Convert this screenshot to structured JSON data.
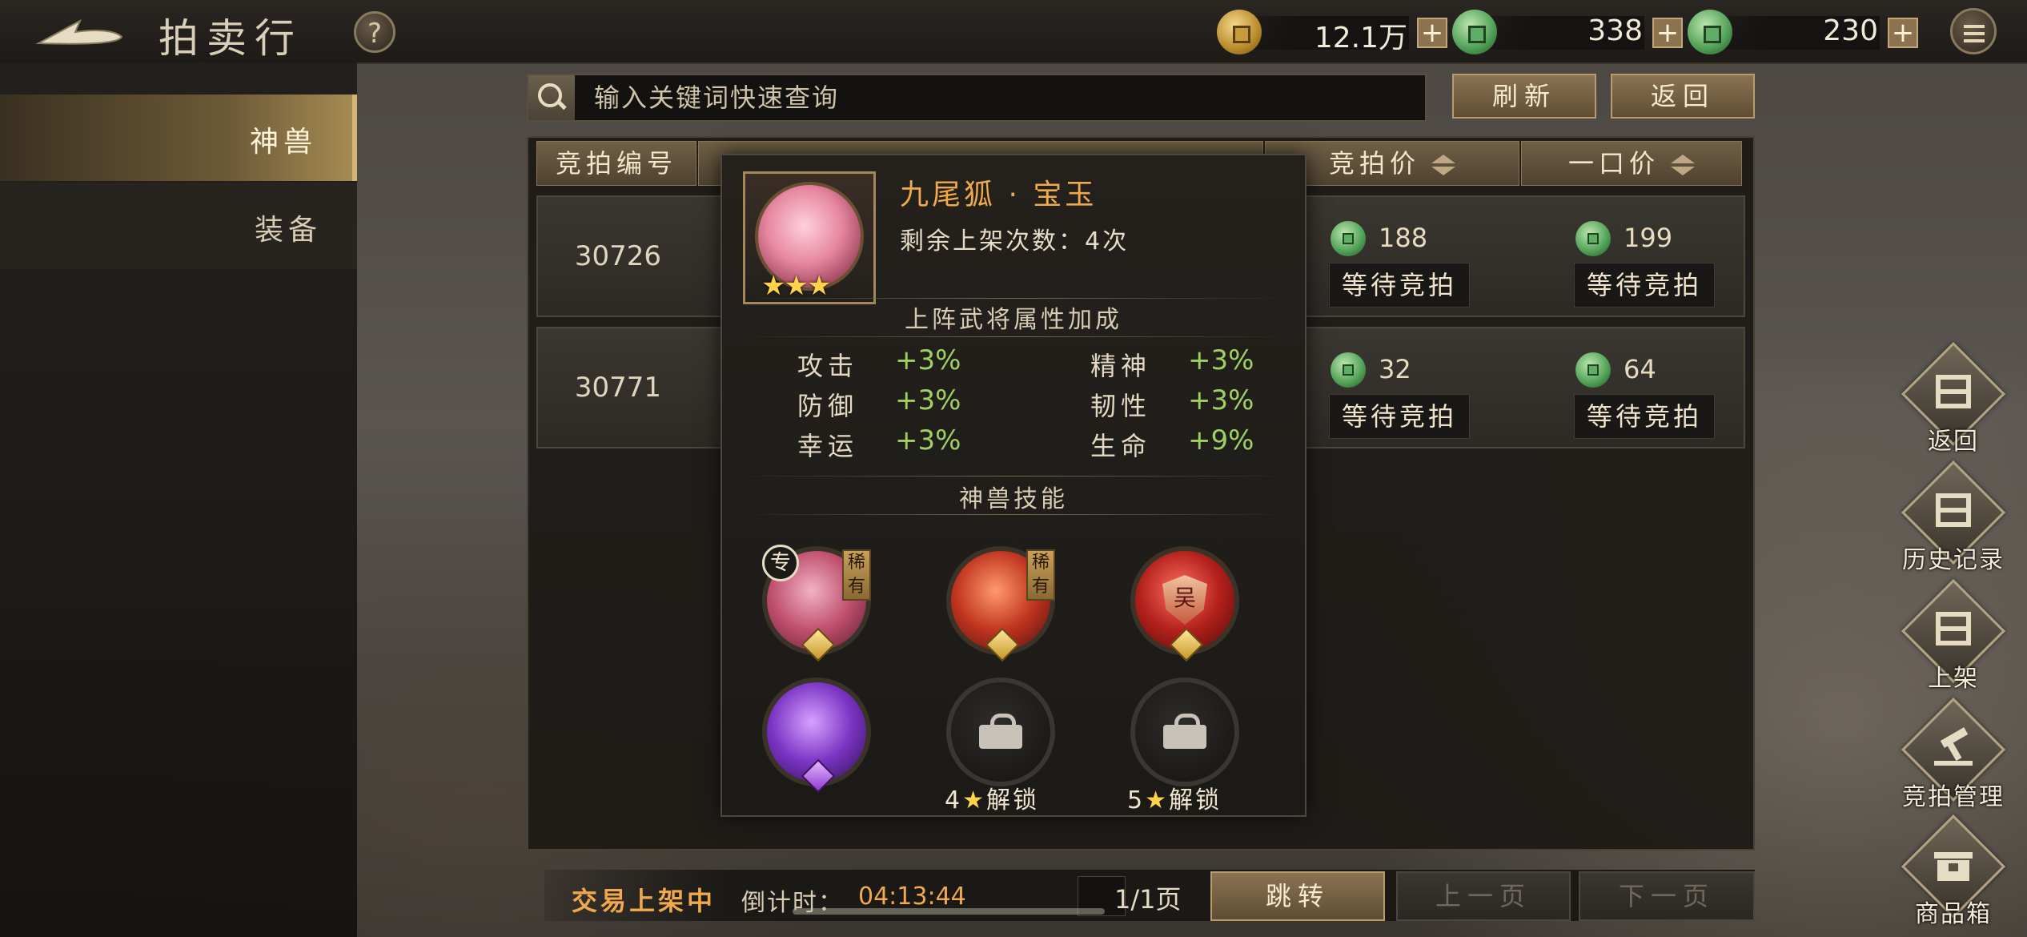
{
  "header": {
    "title": "拍卖行",
    "help_label": "?",
    "currencies": [
      {
        "name": "gold-coin",
        "value": "12.1万"
      },
      {
        "name": "bound-jade-coin",
        "value": "338"
      },
      {
        "name": "jade-coin",
        "value": "230"
      }
    ],
    "plus_label": "+"
  },
  "sidebar": {
    "tabs": [
      {
        "label": "神兽",
        "active": true
      },
      {
        "label": "装备",
        "active": false
      }
    ]
  },
  "search": {
    "placeholder": "输入关键词快速查询",
    "refresh_label": "刷新",
    "back_label": "返回"
  },
  "table": {
    "headers": [
      "竞拍编号",
      "竞拍价",
      "一口价"
    ],
    "rows": [
      {
        "id": "30726",
        "bid_price": "188",
        "buyout_price": "199",
        "bid_status": "等待竞拍",
        "buyout_status": "等待竞拍"
      },
      {
        "id": "30771",
        "bid_price": "32",
        "buyout_price": "64",
        "bid_status": "等待竞拍",
        "buyout_status": "等待竞拍"
      }
    ]
  },
  "popup": {
    "name": "九尾狐 · 宝玉",
    "remaining_listings": "剩余上架次数：4次",
    "star_count": 3,
    "bonus_title": "上阵武将属性加成",
    "stats": [
      {
        "label": "攻击",
        "value": "+3%"
      },
      {
        "label": "精神",
        "value": "+3%"
      },
      {
        "label": "防御",
        "value": "+3%"
      },
      {
        "label": "韧性",
        "value": "+3%"
      },
      {
        "label": "幸运",
        "value": "+3%"
      },
      {
        "label": "生命",
        "value": "+9%"
      }
    ],
    "skills_title": "神兽技能",
    "skills": [
      {
        "icon": "fox-skill-icon",
        "badge": "稀有",
        "tag": "专"
      },
      {
        "icon": "tiger-skill-icon",
        "badge": "稀有"
      },
      {
        "icon": "shield-skill-icon",
        "mark": "吴"
      },
      {
        "icon": "fan-skill-icon"
      },
      {
        "icon": "locked-skill-icon",
        "unlock_stars": "4",
        "unlock_text": "解锁"
      },
      {
        "icon": "locked-skill-icon",
        "unlock_stars": "5",
        "unlock_text": "解锁"
      }
    ]
  },
  "rail": [
    {
      "label": "返回",
      "icon": "return-icon"
    },
    {
      "label": "历史记录",
      "icon": "history-icon"
    },
    {
      "label": "上架",
      "icon": "list-item-icon"
    },
    {
      "label": "竞拍管理",
      "icon": "auction-manage-icon"
    },
    {
      "label": "商品箱",
      "icon": "goods-box-icon"
    }
  ],
  "footer": {
    "status": "交易上架中",
    "countdown_label": "倒计时：",
    "countdown": "04:13:44",
    "page_indicator": "1/1页",
    "jump_label": "跳转",
    "prev_label": "上一页",
    "next_label": "下一页"
  },
  "colors": {
    "accent_orange": "#f0a94c",
    "stat_green": "#9ed162",
    "gold_button": "#8a7353"
  }
}
